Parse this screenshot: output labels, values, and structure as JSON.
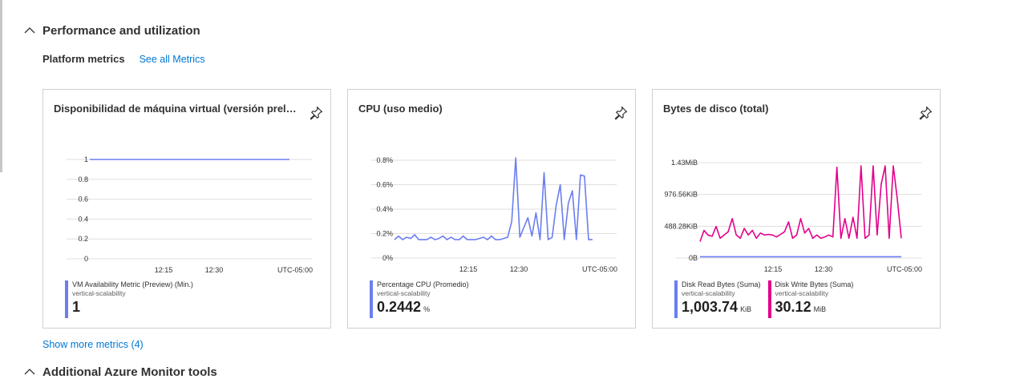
{
  "sections": {
    "performance": {
      "title": "Performance and utilization",
      "expanded": true
    },
    "monitor_tools": {
      "title": "Additional Azure Monitor tools",
      "expanded": true
    }
  },
  "platform_metrics": {
    "label": "Platform metrics",
    "see_all_link": "See all Metrics",
    "show_more_link": "Show more metrics (4)"
  },
  "colors": {
    "accent_link": "#0078d4",
    "series_blue": "#6b7ef0",
    "series_magenta": "#e3008c"
  },
  "tiles": [
    {
      "title": "Disponibilidad de máquina virtual (versión preliminar)",
      "pin_icon": "pin-icon",
      "legend": [
        {
          "name": "VM Availability Metric (Preview) (Min.)",
          "resource": "vertical-scalability",
          "value": "1",
          "unit": "",
          "color": "#6b7ef0"
        }
      ]
    },
    {
      "title": "CPU (uso medio)",
      "pin_icon": "pin-icon",
      "legend": [
        {
          "name": "Percentage CPU (Promedio)",
          "resource": "vertical-scalability",
          "value": "0.2442",
          "unit": "%",
          "color": "#6b7ef0"
        }
      ]
    },
    {
      "title": "Bytes de disco (total)",
      "pin_icon": "pin-icon",
      "legend": [
        {
          "name": "Disk Read Bytes (Suma)",
          "resource": "vertical-scalability",
          "value": "1,003.74",
          "unit": "KiB",
          "color": "#6b7ef0"
        },
        {
          "name": "Disk Write Bytes (Suma)",
          "resource": "vertical-scalability",
          "value": "30.12",
          "unit": "MiB",
          "color": "#e3008c"
        }
      ]
    }
  ],
  "chart_data": [
    {
      "type": "line",
      "title": "Disponibilidad de máquina virtual (versión preliminar)",
      "y_ticks": [
        "1",
        "0.8",
        "0.6",
        "0.4",
        "0.2",
        "0"
      ],
      "x_ticks": [
        "12:15",
        "12:30",
        "UTC-05:00"
      ],
      "ylim": [
        0,
        1
      ],
      "grid": true,
      "series": [
        {
          "name": "VM Availability Metric (Preview) (Min.)",
          "color": "#6b7ef0",
          "values": [
            1,
            1,
            1,
            1,
            1,
            1,
            1,
            1,
            1,
            1,
            1,
            1,
            1,
            1,
            1,
            1,
            1,
            1,
            1,
            1,
            1,
            1,
            1,
            1,
            1,
            1,
            1,
            1,
            1,
            1,
            1,
            1,
            1,
            1,
            1,
            1,
            1,
            1,
            1,
            1,
            1,
            1
          ]
        }
      ]
    },
    {
      "type": "line",
      "title": "CPU (uso medio)",
      "y_ticks": [
        "0.8%",
        "0.6%",
        "0.4%",
        "0.2%",
        "0%"
      ],
      "x_ticks": [
        "12:15",
        "12:30",
        "UTC-05:00"
      ],
      "ylim": [
        0,
        0.8
      ],
      "grid": true,
      "series": [
        {
          "name": "Percentage CPU (Promedio)",
          "color": "#6b7ef0",
          "values": [
            0.15,
            0.18,
            0.15,
            0.17,
            0.16,
            0.19,
            0.15,
            0.15,
            0.15,
            0.17,
            0.15,
            0.16,
            0.18,
            0.15,
            0.17,
            0.15,
            0.15,
            0.18,
            0.15,
            0.15,
            0.15,
            0.16,
            0.17,
            0.15,
            0.18,
            0.15,
            0.15,
            0.16,
            0.17,
            0.3,
            0.82,
            0.17,
            0.25,
            0.33,
            0.18,
            0.37,
            0.15,
            0.7,
            0.15,
            0.17,
            0.43,
            0.6,
            0.15,
            0.45,
            0.55,
            0.15,
            0.68,
            0.67,
            0.15,
            0.15
          ]
        }
      ]
    },
    {
      "type": "line",
      "title": "Bytes de disco (total)",
      "y_ticks": [
        "1.43MiB",
        "976.56KiB",
        "488.28KiB",
        "0B"
      ],
      "x_ticks": [
        "12:15",
        "12:30",
        "UTC-05:00"
      ],
      "ylim": [
        0,
        1.45
      ],
      "y_unit": "MiB",
      "grid": true,
      "series": [
        {
          "name": "Disk Read Bytes (Suma)",
          "color": "#6b7ef0",
          "values": [
            0.02,
            0.02,
            0.02,
            0.02,
            0.02,
            0.02,
            0.02,
            0.02,
            0.02,
            0.02,
            0.02,
            0.02,
            0.02,
            0.02,
            0.02,
            0.02,
            0.02,
            0.02,
            0.02,
            0.02,
            0.02,
            0.02,
            0.02,
            0.02,
            0.02,
            0.02,
            0.02,
            0.02,
            0.02,
            0.02,
            0.02,
            0.02,
            0.02,
            0.02,
            0.02,
            0.02,
            0.02,
            0.02,
            0.02,
            0.02,
            0.02,
            0.02,
            0.02,
            0.02,
            0.02,
            0.02,
            0.02,
            0.02,
            0.02,
            0.02
          ]
        },
        {
          "name": "Disk Write Bytes (Suma)",
          "color": "#e3008c",
          "values": [
            0.25,
            0.42,
            0.35,
            0.33,
            0.48,
            0.3,
            0.35,
            0.4,
            0.6,
            0.35,
            0.3,
            0.45,
            0.35,
            0.42,
            0.3,
            0.38,
            0.35,
            0.36,
            0.35,
            0.32,
            0.36,
            0.4,
            0.55,
            0.3,
            0.35,
            0.6,
            0.38,
            0.45,
            0.3,
            0.35,
            0.3,
            0.32,
            0.35,
            0.32,
            1.38,
            0.3,
            0.6,
            0.3,
            0.62,
            0.3,
            1.4,
            0.3,
            0.35,
            1.4,
            0.35,
            1.12,
            1.4,
            0.3,
            1.4,
            0.9,
            0.3
          ]
        }
      ]
    }
  ]
}
